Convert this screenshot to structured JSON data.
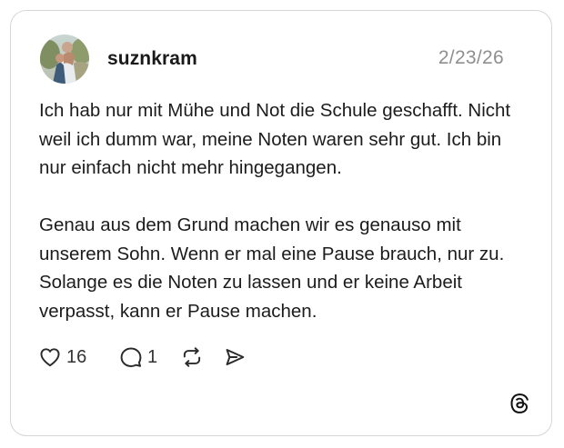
{
  "post": {
    "username": "suznkram",
    "date": "2/23/26",
    "paragraphs": [
      "Ich hab nur mit Mühe und Not die Schule geschafft. Nicht weil ich dumm war, meine Noten waren sehr gut. Ich bin nur einfach nicht mehr hingegangen.",
      "Genau aus dem Grund machen wir es genauso mit unserem Sohn. Wenn er mal eine Pause brauch, nur zu. Solange es die Noten zu lassen und er keine Arbeit verpasst, kann er Pause machen."
    ]
  },
  "actions": {
    "like_count": "16",
    "reply_count": "1",
    "like_icon": "heart-icon",
    "reply_icon": "comment-icon",
    "repost_icon": "repost-icon",
    "share_icon": "send-icon"
  },
  "brand": {
    "logo": "threads-logo-icon"
  }
}
